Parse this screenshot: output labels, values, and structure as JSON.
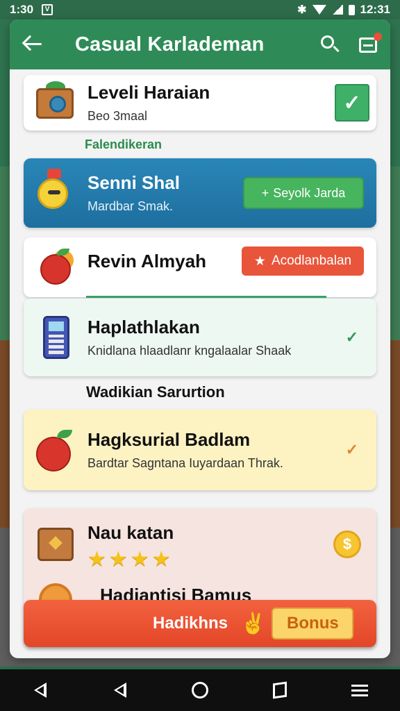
{
  "status_bar": {
    "time": "1:30",
    "notification_glyph": "V",
    "clock_right": "12:31"
  },
  "header": {
    "title": "Casual Karlademan"
  },
  "items": [
    {
      "title": "Leveli Haraian",
      "subtitle": "Beo 3maal",
      "icon": "treasure-chest-icon"
    },
    {
      "title": "Senni Shal",
      "subtitle": "Mardbar Smak.",
      "button_label": "Seyolk Jarda",
      "button_prefix": "+",
      "icon": "chick-mascot-icon"
    },
    {
      "title": "Revin Almyah",
      "button_label": "Acodlanbalan",
      "icon": "fruit-basket-icon"
    },
    {
      "title": "Haplathlakan",
      "subtitle": "Knidlana hlaadlanr kngalaalar Shaak",
      "icon": "calculator-phone-icon"
    },
    {
      "title": "Hagksurial Badlam",
      "subtitle": "Bardtar Sagntana Iuyardaan Thrak.",
      "icon": "apple-icon"
    },
    {
      "title": "Nau katan",
      "stars": 4,
      "icon": "gift-box-icon"
    }
  ],
  "section_label": "Falendikeran",
  "sub_heading": "Wadikian Sarurtion",
  "partial_item_title": "Hadiantisi Bamus",
  "bonus_bar": {
    "label": "Hadikhns",
    "button_label": "Bonus"
  },
  "colors": {
    "primary_green": "#2e8b57",
    "blue_card": "#2a86b8",
    "accent_orange": "#e8553a",
    "star_gold": "#f5c21b"
  }
}
